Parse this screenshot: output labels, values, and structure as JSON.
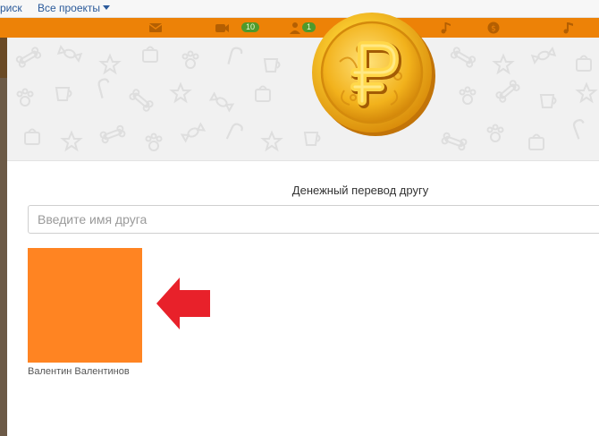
{
  "topnav": {
    "partial_label": "риск",
    "projects_label": "Все проекты"
  },
  "toolbar": {
    "badge_1": "10",
    "badge_2": "1",
    "icons": [
      "mail-icon",
      "camera-icon",
      "person-icon",
      "music-icon",
      "ruble-icon",
      "note-icon"
    ]
  },
  "colors": {
    "toolbar": "#ed8207",
    "avatar": "#ff8422",
    "arrow": "#e8212a",
    "coin": "#f4b820"
  },
  "modal": {
    "title": "Денежный перевод другу",
    "search_placeholder": "Введите имя друга",
    "friends": [
      {
        "name": "Валентин Валентинов"
      }
    ]
  }
}
